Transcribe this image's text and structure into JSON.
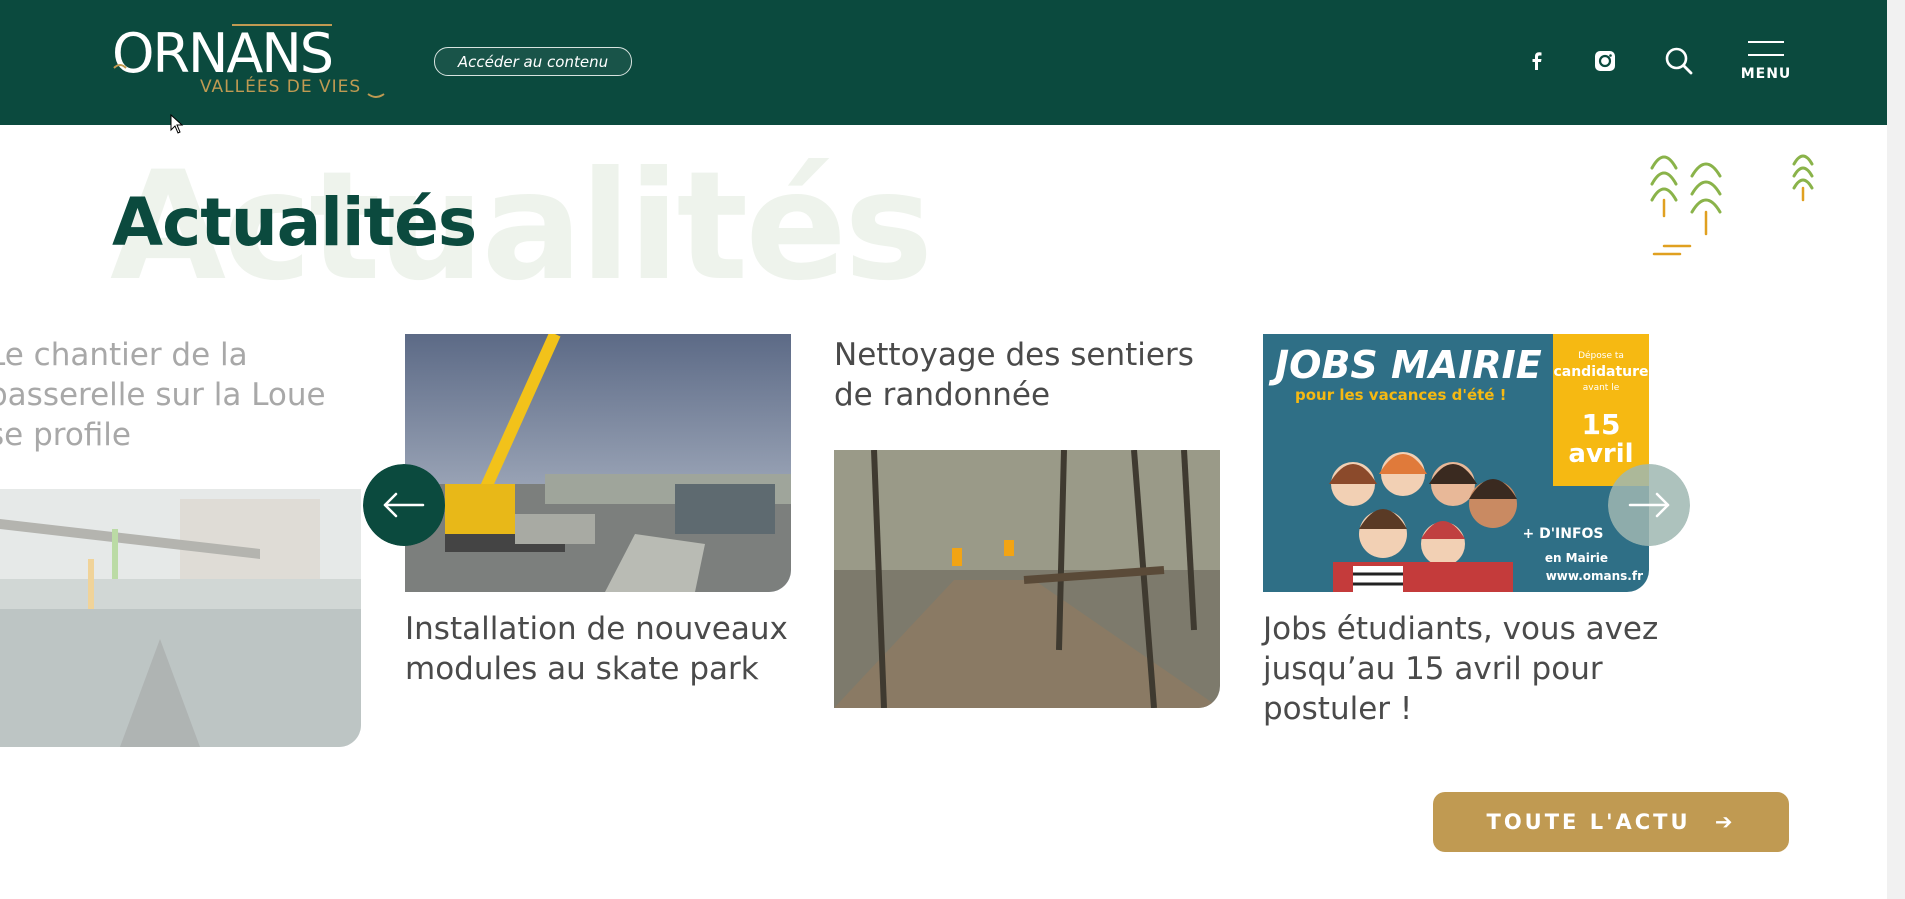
{
  "header": {
    "logo_text": "ORNANS",
    "logo_tagline": "VALLÉES DE VIES",
    "skip_link": "Accéder au contenu",
    "menu_label": "MENU",
    "social": [
      "facebook-icon",
      "instagram-icon"
    ]
  },
  "section": {
    "background_word": "Actualités",
    "title": "Actualités"
  },
  "cards": [
    {
      "title": "Le chantier de la passerelle sur la Loue se profile"
    },
    {
      "title": "Installation de nouveaux modules au skate park"
    },
    {
      "title": "Nettoyage des sentiers de randonnée"
    },
    {
      "title": "Jobs étudiants, vous avez jusqu’au 15 avril pour postuler !"
    }
  ],
  "jobs_poster": {
    "headline": "JOBS MAIRIE",
    "sub": "pour les vacances d'été !",
    "deadline_top": "Dépose ta",
    "deadline_mid": "candidature",
    "deadline_small": "avant le",
    "day": "15",
    "month": "avril",
    "info": "+ D'INFOS",
    "info_place": "en Mairie",
    "url": "www.omans.fr"
  },
  "cta": {
    "label": "TOUTE L'ACTU"
  },
  "colors": {
    "brand_green": "#0b4a3e",
    "gold": "#c09a52",
    "leaf": "#8ab34a",
    "poster_blue": "#2f6f86",
    "poster_yellow": "#f6b912"
  }
}
